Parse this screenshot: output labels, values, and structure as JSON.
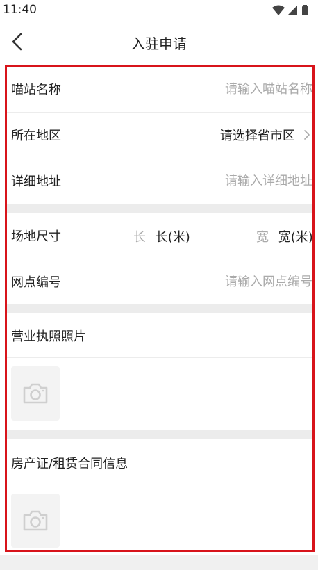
{
  "status_bar": {
    "time": "11:40"
  },
  "header": {
    "title": "入驻申请"
  },
  "form": {
    "station_name": {
      "label": "喵站名称",
      "placeholder": "请输入喵站名称"
    },
    "region": {
      "label": "所在地区",
      "value": "请选择省市区"
    },
    "address": {
      "label": "详细地址",
      "placeholder": "请输入详细地址"
    },
    "site_size": {
      "label": "场地尺寸",
      "length_hint": "长",
      "length_value": "长(米)",
      "width_hint": "宽",
      "width_value": "宽(米)"
    },
    "outlet_number": {
      "label": "网点编号",
      "placeholder": "请输入网点编号"
    },
    "business_license": {
      "label": "营业执照照片"
    },
    "property_certificate": {
      "label": "房产证/租赁合同信息"
    }
  },
  "icons": {
    "back": "chevron-left-icon",
    "region_select": "chevron-right-icon",
    "photo_upload": "camera-icon",
    "wifi": "wifi-icon",
    "signal": "signal-icon",
    "battery": "battery-icon"
  },
  "colors": {
    "highlight_border": "#d8141b",
    "section_gap": "#ececec",
    "placeholder": "#aaaaaa",
    "text": "#222222"
  }
}
